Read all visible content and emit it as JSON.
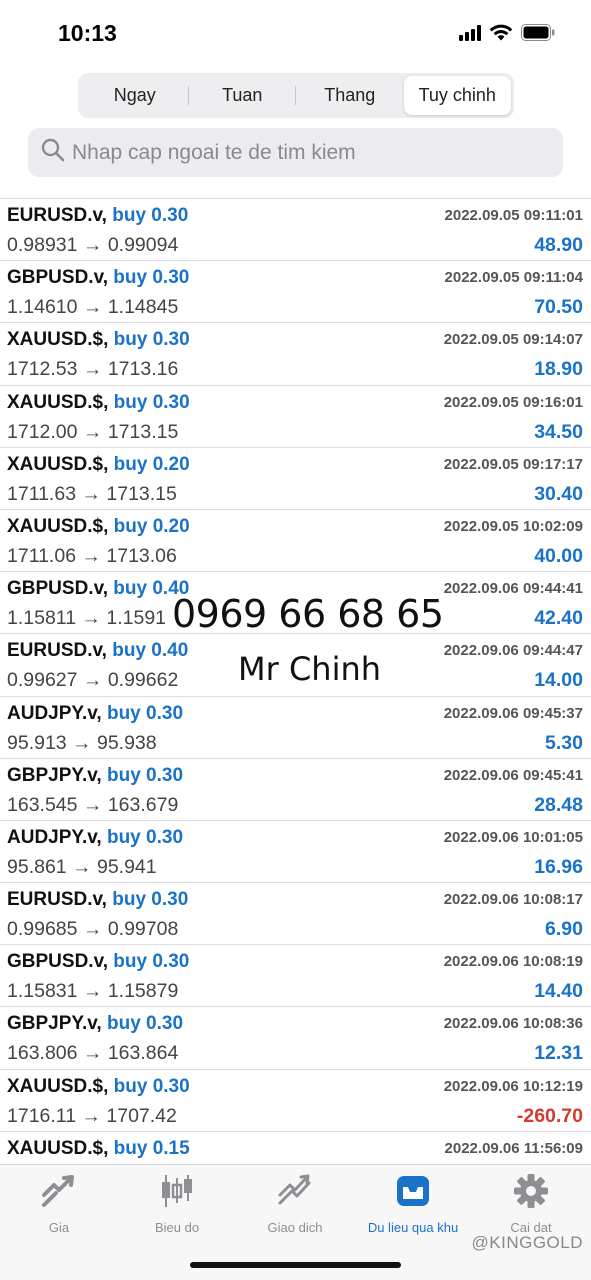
{
  "status": {
    "time": "10:13"
  },
  "segments": [
    {
      "label": "Ngay",
      "active": false
    },
    {
      "label": "Tuan",
      "active": false
    },
    {
      "label": "Thang",
      "active": false
    },
    {
      "label": "Tuy chinh",
      "active": true
    }
  ],
  "search": {
    "placeholder": "Nhap cap ngoai te de tim kiem"
  },
  "trades": [
    {
      "symbol": "EURUSD.v,",
      "side": "buy 0.30",
      "prices": "0.98931 → 0.99094",
      "time": "2022.09.05 09:11:01",
      "profit": "48.90"
    },
    {
      "symbol": "GBPUSD.v,",
      "side": "buy 0.30",
      "prices": "1.14610 → 1.14845",
      "time": "2022.09.05 09:11:04",
      "profit": "70.50"
    },
    {
      "symbol": "XAUUSD.$,",
      "side": "buy 0.30",
      "prices": "1712.53 → 1713.16",
      "time": "2022.09.05 09:14:07",
      "profit": "18.90"
    },
    {
      "symbol": "XAUUSD.$,",
      "side": "buy 0.30",
      "prices": "1712.00 → 1713.15",
      "time": "2022.09.05 09:16:01",
      "profit": "34.50"
    },
    {
      "symbol": "XAUUSD.$,",
      "side": "buy 0.20",
      "prices": "1711.63 → 1713.15",
      "time": "2022.09.05 09:17:17",
      "profit": "30.40"
    },
    {
      "symbol": "XAUUSD.$,",
      "side": "buy 0.20",
      "prices": "1711.06 → 1713.06",
      "time": "2022.09.05 10:02:09",
      "profit": "40.00"
    },
    {
      "symbol": "GBPUSD.v,",
      "side": "buy 0.40",
      "prices": "1.15811 → 1.1591",
      "time": "2022.09.06 09:44:41",
      "profit": "42.40"
    },
    {
      "symbol": "EURUSD.v,",
      "side": "buy 0.40",
      "prices": "0.99627 → 0.99662",
      "time": "2022.09.06 09:44:47",
      "profit": "14.00"
    },
    {
      "symbol": "AUDJPY.v,",
      "side": "buy 0.30",
      "prices": "95.913 → 95.938",
      "time": "2022.09.06 09:45:37",
      "profit": "5.30"
    },
    {
      "symbol": "GBPJPY.v,",
      "side": "buy 0.30",
      "prices": "163.545 → 163.679",
      "time": "2022.09.06 09:45:41",
      "profit": "28.48"
    },
    {
      "symbol": "AUDJPY.v,",
      "side": "buy 0.30",
      "prices": "95.861 → 95.941",
      "time": "2022.09.06 10:01:05",
      "profit": "16.96"
    },
    {
      "symbol": "EURUSD.v,",
      "side": "buy 0.30",
      "prices": "0.99685 → 0.99708",
      "time": "2022.09.06 10:08:17",
      "profit": "6.90"
    },
    {
      "symbol": "GBPUSD.v,",
      "side": "buy 0.30",
      "prices": "1.15831 → 1.15879",
      "time": "2022.09.06 10:08:19",
      "profit": "14.40"
    },
    {
      "symbol": "GBPJPY.v,",
      "side": "buy 0.30",
      "prices": "163.806 → 163.864",
      "time": "2022.09.06 10:08:36",
      "profit": "12.31"
    },
    {
      "symbol": "XAUUSD.$,",
      "side": "buy 0.30",
      "prices": "1716.11 → 1707.42",
      "time": "2022.09.06 10:12:19",
      "profit": "-260.70"
    },
    {
      "symbol": "XAUUSD.$,",
      "side": "buy 0.15",
      "prices": "",
      "time": "2022.09.06 11:56:09",
      "profit": ""
    }
  ],
  "watermark": {
    "phone": "0969 66 68 65",
    "name": "Mr Chinh"
  },
  "tabs": [
    {
      "label": "Gia",
      "icon": "quotes-icon",
      "active": false
    },
    {
      "label": "Bieu do",
      "icon": "chart-icon",
      "active": false
    },
    {
      "label": "Giao dich",
      "icon": "trade-icon",
      "active": false
    },
    {
      "label": "Du lieu qua khu",
      "icon": "history-icon",
      "active": true
    },
    {
      "label": "Cai dat",
      "icon": "gear-icon",
      "active": false
    }
  ],
  "footer_mark": "@KINGGOLD",
  "colors": {
    "accent": "#1a73c9",
    "negative": "#d63a2f"
  }
}
